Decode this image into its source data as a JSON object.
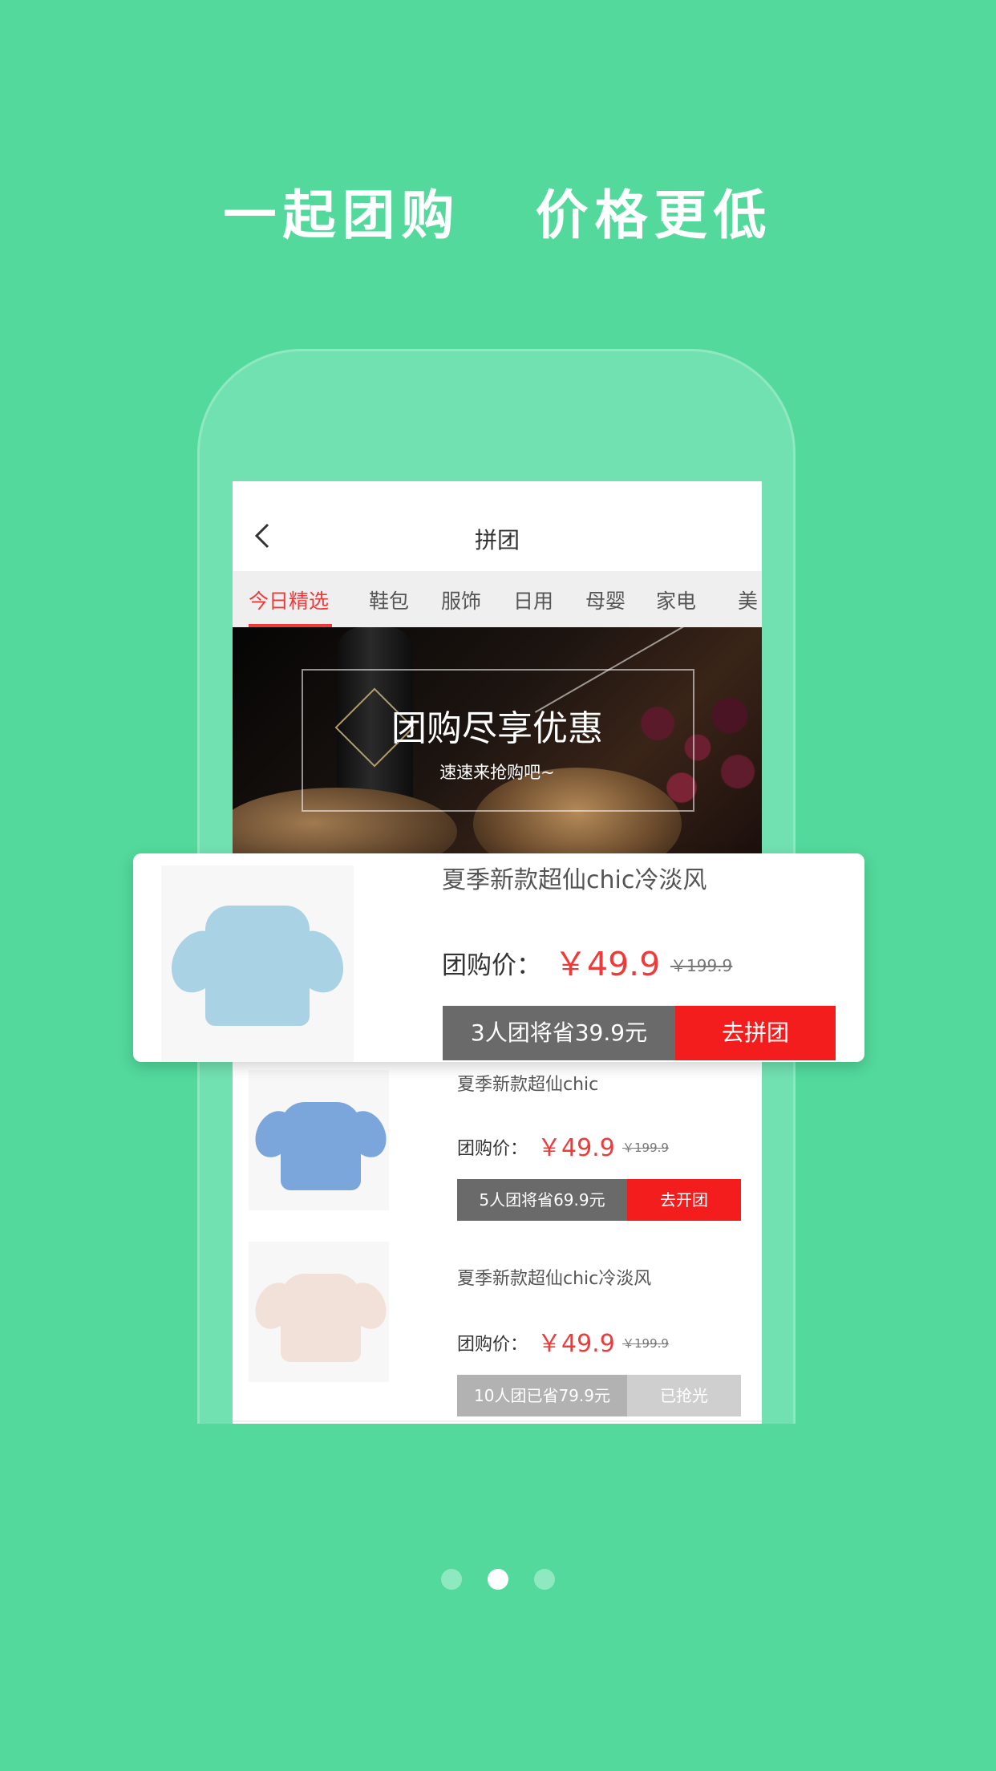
{
  "headline": "一起团购   价格更低",
  "app": {
    "title": "拼团",
    "back_icon": "chevron-left-icon",
    "tabs": [
      {
        "label": "今日精选",
        "active": true
      },
      {
        "label": "鞋包"
      },
      {
        "label": "服饰"
      },
      {
        "label": "日用"
      },
      {
        "label": "母婴"
      },
      {
        "label": "家电"
      },
      {
        "label": "美"
      }
    ],
    "banner": {
      "title": "团购尽享优惠",
      "subtitle": "速速来抢购吧~"
    }
  },
  "featured": {
    "title": "夏季新款超仙chic冷淡风",
    "price_label": "团购价：",
    "price": "￥49.9",
    "original_price": "￥199.9",
    "group_text": "3人团将省39.9元",
    "action": "去拼团",
    "shirt_color": "#a9d2e4"
  },
  "items": [
    {
      "title": "夏季新款超仙chic",
      "price_label": "团购价：",
      "price": "￥49.9",
      "original_price": "￥199.9",
      "group_text": "5人团将省69.9元",
      "action": "去开团",
      "shirt_color": "#7aa6dc"
    },
    {
      "title": "夏季新款超仙chic冷淡风",
      "price_label": "团购价：",
      "price": "￥49.9",
      "original_price": "￥199.9",
      "group_text": "10人团已省79.9元",
      "action": "已抢光",
      "sold_out": true,
      "shirt_color": "#f1e1d8"
    }
  ],
  "pager": {
    "count": 3,
    "active_index": 1
  },
  "colors": {
    "background": "#52d99b",
    "accent_red": "#f41d1d",
    "price_red": "#f03a3a"
  }
}
